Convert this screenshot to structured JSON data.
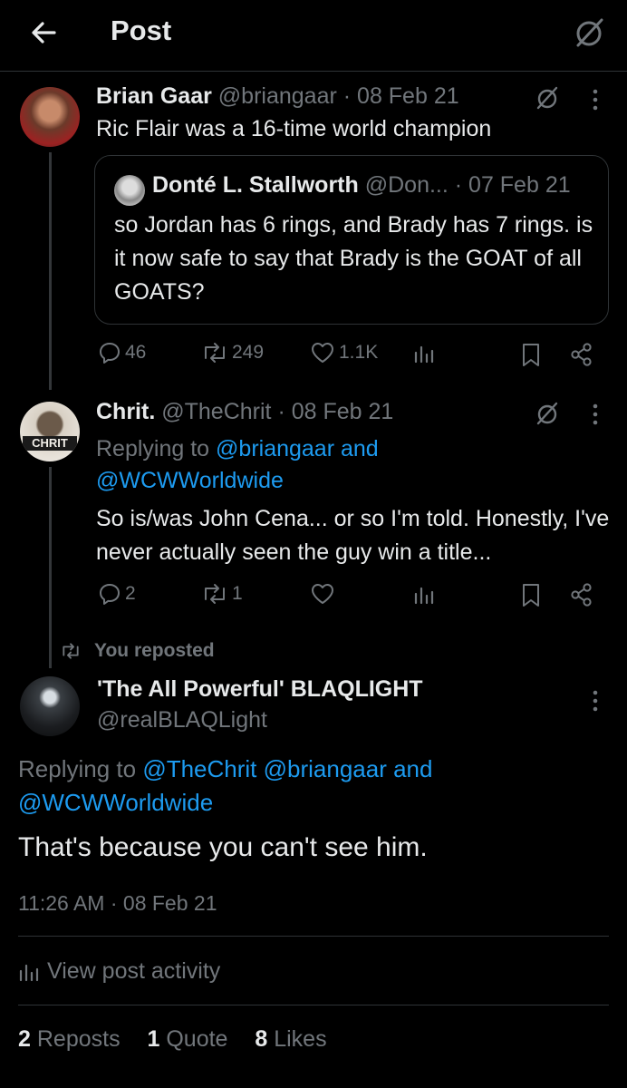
{
  "header": {
    "title": "Post"
  },
  "tweet1": {
    "name": "Brian Gaar",
    "handle": "@briangaar",
    "date": "· 08 Feb 21",
    "text": "Ric Flair was a 16-time world champion",
    "quote": {
      "name": "Donté L. Stallworth",
      "handle": "@Don...",
      "date": "· 07 Feb 21",
      "text": "so Jordan has 6 rings, and Brady has 7 rings. is it now safe to say that Brady is the GOAT of all GOATS?"
    },
    "replies": "46",
    "reposts": "249",
    "likes": "1.1K"
  },
  "tweet2": {
    "name": "Chrit.",
    "handle": "@TheChrit",
    "date": "· 08 Feb 21",
    "avatar_text": "CHRIT",
    "replying_prefix": "Replying to",
    "replying_to_1": "@briangaar and",
    "replying_to_2": "@WCWWorldwide",
    "text": "So is/was John Cena... or so I'm told. Honestly, I've never actually seen the guy win a title...",
    "replies": "2",
    "reposts": "1"
  },
  "repost_label": "You reposted",
  "main": {
    "name": "'The All Powerful' BLAQLIGHT",
    "handle": "@realBLAQLight",
    "replying_prefix": "Replying to",
    "replying_to_1": "@TheChrit @briangaar and",
    "replying_to_2": "@WCWWorldwide",
    "text": "That's because you can't see him.",
    "timestamp": "11:26 AM · 08 Feb 21",
    "view_activity": "View post activity",
    "stats": {
      "reposts_count": "2",
      "reposts_label": "Reposts",
      "quotes_count": "1",
      "quotes_label": "Quote",
      "likes_count": "8",
      "likes_label": "Likes"
    }
  },
  "colors": {
    "background": "#000000",
    "text": "#e7e9ea",
    "muted": "#71767b",
    "link": "#1d9bf0",
    "border": "#2f3336"
  }
}
